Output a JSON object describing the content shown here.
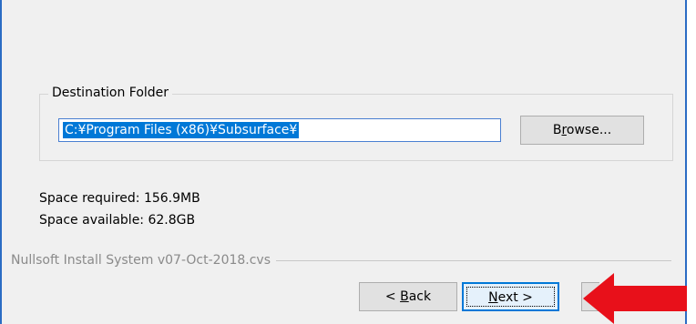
{
  "destination_folder": {
    "legend": "Destination Folder",
    "path_value": "C:¥Program Files (x86)¥Subsurface¥",
    "browse_label_pre": "B",
    "browse_label_accel": "r",
    "browse_label_post": "owse..."
  },
  "space": {
    "required": "Space required: 156.9MB",
    "available": "Space available: 62.8GB"
  },
  "branding": "Nullsoft Install System v07-Oct-2018.cvs",
  "buttons": {
    "back_pre": "< ",
    "back_accel": "B",
    "back_post": "ack",
    "next_accel": "N",
    "next_post": "ext >"
  },
  "colors": {
    "window_bg": "#f0f0f0",
    "selection": "#0078d7",
    "annotation_arrow": "#e8101a"
  },
  "icons": {
    "annotation": "red-arrow-icon"
  }
}
